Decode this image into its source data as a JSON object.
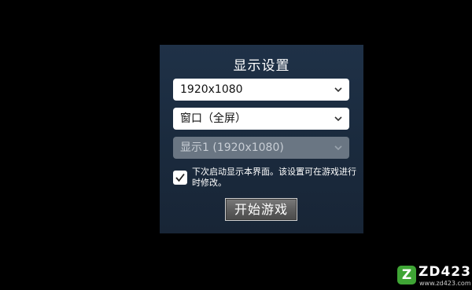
{
  "dialog": {
    "title": "显示设置",
    "resolution_value": "1920x1080",
    "window_mode_value": "窗口（全屏）",
    "display_value": "显示1 (1920x1080)",
    "display_disabled": true,
    "show_on_startup_checked": true,
    "show_on_startup_label": "下次启动显示本界面。该设置可在游戏进行时修改。",
    "start_button_label": "开始游戏"
  },
  "watermark": {
    "logo_letter": "Z",
    "brand": "ZD423",
    "url": "www.zd423.com"
  },
  "colors": {
    "background": "#000000",
    "panel": "#1e2f44",
    "select_bg": "#ffffff",
    "select_disabled_bg": "#6a7683",
    "watermark_green": "#3fa535"
  }
}
